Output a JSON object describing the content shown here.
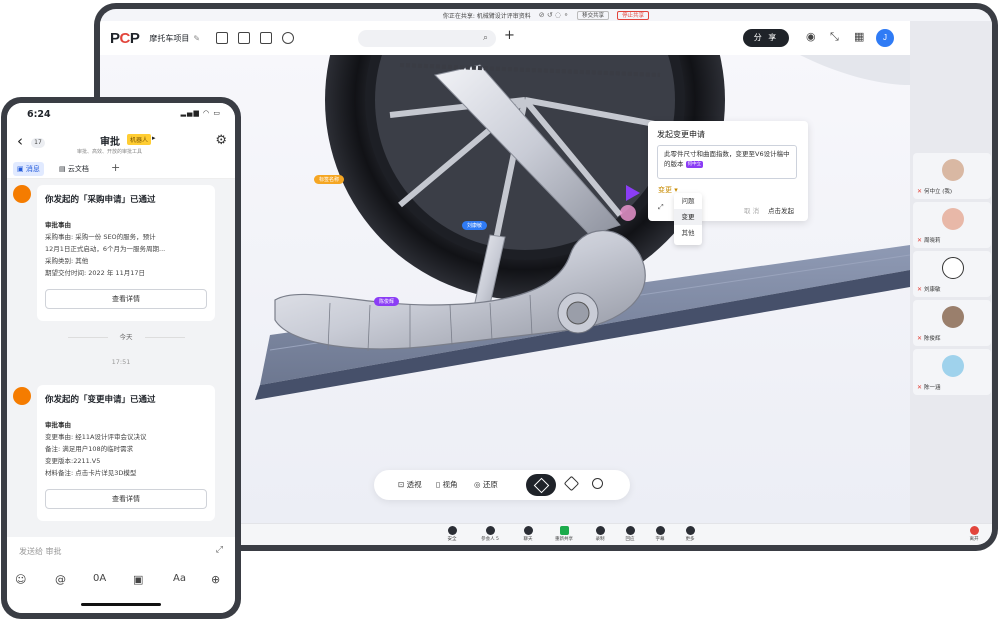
{
  "tablet": {
    "share_bar": {
      "status_text": "你正在共享: 机械臂设计评审资料",
      "stop_share_label": "移交共享",
      "end_share_label": "停止共享"
    },
    "header": {
      "logo_p": "P",
      "logo_c": "C",
      "logo_p2": "P",
      "project_name": "摩托车项目",
      "search_placeholder": "",
      "share_label": "分 享",
      "avatar_initial": "J"
    },
    "labels": {
      "tag1": "标签名称",
      "tag2": "刘康敏",
      "tag3": "陈俊辉"
    },
    "change_request": {
      "title": "发起变更申请",
      "text": "此零件尺寸和曲面指数，变更至V6设计稿中的版本",
      "badge": "何中立",
      "type_value": "变更",
      "cancel_label": "取 消",
      "submit_label": "点击发起",
      "menu": [
        "问题",
        "变更",
        "其他"
      ],
      "menu_active": "变更"
    },
    "viewport_toolbar": {
      "perspective_label": "透视",
      "view_label": "视角",
      "restore_label": "还原"
    },
    "participants": [
      {
        "name": "何中立 (我)"
      },
      {
        "name": "周晓莉"
      },
      {
        "name": "刘康敏"
      },
      {
        "name": "陈俊辉"
      },
      {
        "name": "陈一涵"
      }
    ],
    "meeting_bar": {
      "items": [
        "安全",
        "参会人",
        "聊天",
        "重新共享",
        "录制",
        "回应",
        "字幕",
        "更多"
      ],
      "participant_count": "5",
      "leave_label": "离开"
    }
  },
  "phone": {
    "time": "6:24",
    "status_icons": "▂▄▆ ◠ ▭",
    "nav": {
      "back_count": "17",
      "title": "审批",
      "bot_badge": "机器人",
      "subtitle": "审批、高效、开放的审批工具"
    },
    "tabs": {
      "messages": "消息",
      "cloud_docs": "云文档"
    },
    "messages": [
      {
        "title": "你发起的「采购申请」已通过",
        "section": "审批事由",
        "lines": [
          "采购事由: 采购一份 SEO的服务，预计",
          "12月1日正式启动，6个月为一服务周期...",
          "采购类别: 其他",
          "期望交付时间: 2022 年 11月17日"
        ],
        "button": "查看详情"
      },
      {
        "title": "你发起的「变更申请」已通过",
        "section": "审批事由",
        "lines": [
          "变更事由: 经11A设计评审会议决议",
          "备注: 满足用户108的临时需求",
          "变更版本:2211.V5",
          "材料备注: 点击卡片详见3D模型"
        ],
        "button": "查看详情"
      }
    ],
    "divider_today": "今天",
    "msg_time": "17:51",
    "composer": {
      "placeholder": "发送给 审批"
    }
  }
}
